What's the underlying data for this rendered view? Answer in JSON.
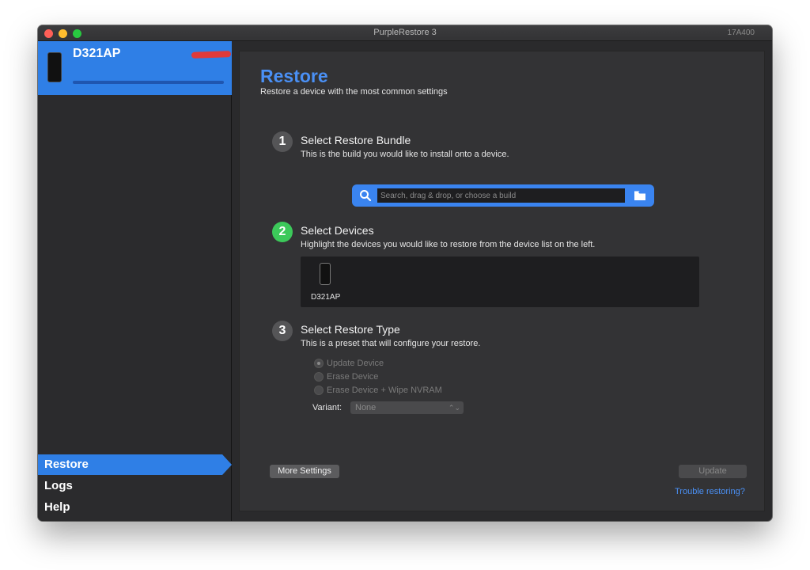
{
  "window": {
    "title": "PurpleRestore 3",
    "build": "17A400"
  },
  "sidebar": {
    "device": {
      "name": "D321AP",
      "progress_fraction": 0.0
    },
    "nav": [
      {
        "label": "Restore",
        "active": true
      },
      {
        "label": "Logs",
        "active": false
      },
      {
        "label": "Help",
        "active": false
      }
    ]
  },
  "main": {
    "title": "Restore",
    "subtitle": "Restore a device with the most common settings",
    "steps": [
      {
        "number": "1",
        "title": "Select Restore Bundle",
        "description": "This is the build you would like to install onto a device."
      },
      {
        "number": "2",
        "title": "Select Devices",
        "description": "Highlight the devices you would like to restore from the device list on the left."
      },
      {
        "number": "3",
        "title": "Select Restore Type",
        "description": "This is a preset that will configure your restore."
      }
    ],
    "bundle_search": {
      "placeholder": "Search, drag & drop, or choose a build",
      "value": ""
    },
    "device_list": [
      {
        "label": "D321AP"
      }
    ],
    "restore_types": [
      {
        "label": "Update Device",
        "checked": true
      },
      {
        "label": "Erase Device",
        "checked": false
      },
      {
        "label": "Erase Device + Wipe NVRAM",
        "checked": false
      }
    ],
    "variant": {
      "label": "Variant:",
      "selected": "None"
    },
    "more_settings_label": "More Settings",
    "update_label": "Update",
    "trouble_link": "Trouble restoring?"
  },
  "colors": {
    "accent": "#2f7fe6",
    "step_active": "#3cc95a",
    "link": "#4a90f5"
  },
  "icons": {
    "search": "search-icon",
    "folder": "folder-icon",
    "device": "device-icon"
  }
}
